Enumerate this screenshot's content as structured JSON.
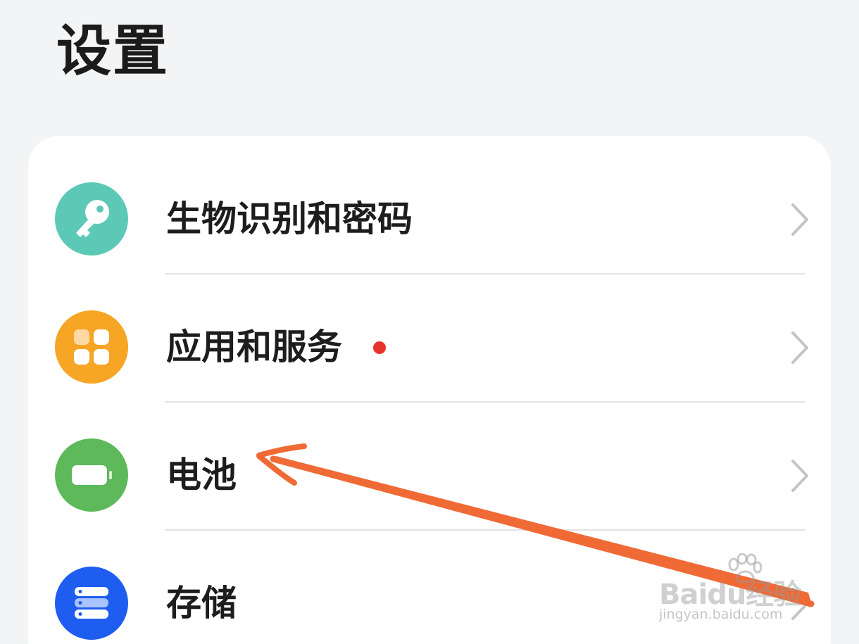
{
  "page": {
    "title": "设置"
  },
  "settings": {
    "items": [
      {
        "label": "生物识别和密码",
        "icon": "key-icon",
        "icon_color": "#5cc9b7"
      },
      {
        "label": "应用和服务",
        "icon": "apps-grid-icon",
        "icon_color": "#f6a524",
        "has_badge": true,
        "badge_color": "#e8322c"
      },
      {
        "label": "电池",
        "icon": "battery-icon",
        "icon_color": "#5db95a"
      },
      {
        "label": "存储",
        "icon": "storage-icon",
        "icon_color": "#1f5cf0"
      }
    ]
  },
  "annotation": {
    "arrow_color": "#f06a36",
    "target": "电池"
  },
  "watermark": {
    "brand": "Baidu经验",
    "url": "jingyan.baidu.com"
  }
}
